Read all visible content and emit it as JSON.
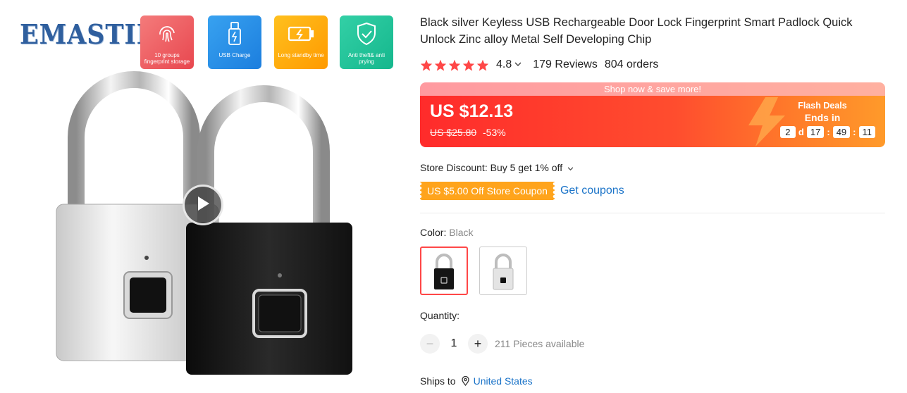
{
  "brand": "EMASTIFF",
  "features": [
    {
      "label": "10 groups fingerprint storage",
      "icon": "fingerprint-icon"
    },
    {
      "label": "USB Charge",
      "icon": "usb-icon"
    },
    {
      "label": "Long standby time",
      "icon": "battery-icon"
    },
    {
      "label": "Anti theft& anti prying",
      "icon": "shield-icon"
    }
  ],
  "product": {
    "title": "Black silver Keyless USB Rechargeable Door Lock Fingerprint Smart Padlock Quick Unlock Zinc alloy Metal Self Developing Chip",
    "rating": "4.8",
    "stars": 5,
    "reviews": "179 Reviews",
    "orders": "804 orders"
  },
  "price": {
    "banner": "Shop now & save more!",
    "current": "US $12.13",
    "original": "US $25.80",
    "discount": "-53%",
    "flash_title": "Flash Deals",
    "ends_in": "Ends in",
    "timer": {
      "days": "2",
      "d_label": "d",
      "hours": "17",
      "minutes": "49",
      "seconds": "11"
    }
  },
  "store": {
    "discount_label": "Store Discount: Buy 5 get 1% off",
    "coupon": "US $5.00 Off Store Coupon",
    "get_coupons": "Get coupons"
  },
  "color": {
    "label": "Color:",
    "selected": "Black",
    "options": [
      "Black",
      "Silver"
    ]
  },
  "quantity": {
    "label": "Quantity:",
    "value": "1",
    "available": "211 Pieces available"
  },
  "shipping": {
    "label": "Ships to",
    "country": "United States"
  },
  "colors": {
    "accent": "#ff4747",
    "price_gradient_start": "#ff2b2b",
    "price_gradient_end": "#ff9a2a",
    "coupon": "#ffa41c",
    "link": "#1a73c8",
    "star": "#ff4747"
  }
}
